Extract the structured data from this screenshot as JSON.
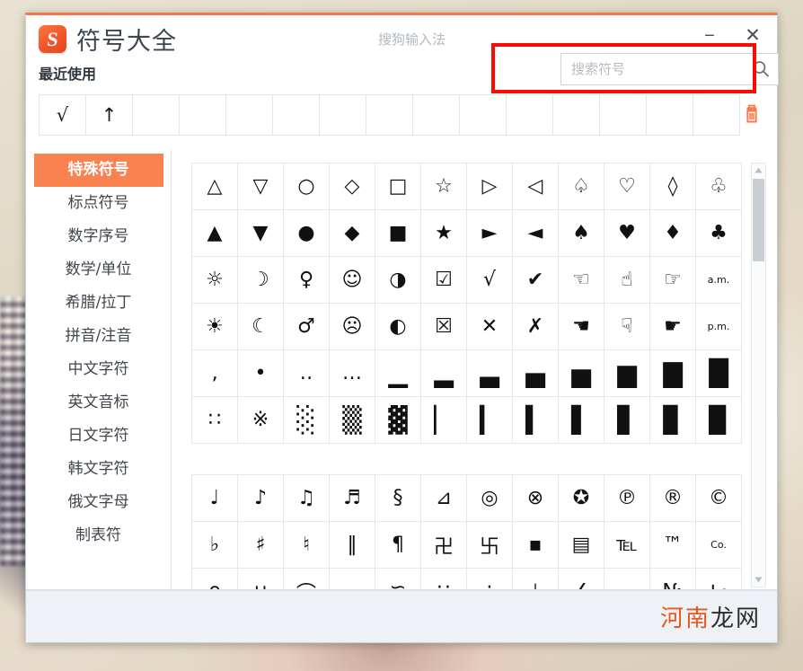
{
  "window": {
    "app_title": "符号大全",
    "product_name": "搜狗输入法",
    "logo_letter": "S",
    "accent_color": "#f2784b",
    "minimize_label": "−",
    "close_label": "✕"
  },
  "recent": {
    "label": "最近使用",
    "symbols": [
      "√",
      "↑",
      "",
      "",
      "",
      "",
      "",
      "",
      "",
      "",
      "",
      "",
      "",
      "",
      ""
    ],
    "clear_tooltip": "清空"
  },
  "search": {
    "placeholder": "搜索符号",
    "value": "",
    "icon": "search-icon",
    "highlight_color": "#fb0b06"
  },
  "sidebar": {
    "items": [
      {
        "label": "特殊符号",
        "active": true
      },
      {
        "label": "标点符号",
        "active": false
      },
      {
        "label": "数字序号",
        "active": false
      },
      {
        "label": "数学/单位",
        "active": false
      },
      {
        "label": "希腊/拉丁",
        "active": false
      },
      {
        "label": "拼音/注音",
        "active": false
      },
      {
        "label": "中文字符",
        "active": false
      },
      {
        "label": "英文音标",
        "active": false
      },
      {
        "label": "日文字符",
        "active": false
      },
      {
        "label": "韩文字符",
        "active": false
      },
      {
        "label": "俄文字母",
        "active": false
      },
      {
        "label": "制表符",
        "active": false
      }
    ],
    "active_bg": "#fa8250"
  },
  "symbol_groups": [
    {
      "name": "shapes-and-marks",
      "rows": [
        [
          "△",
          "▽",
          "○",
          "◇",
          "□",
          "☆",
          "▷",
          "◁",
          "♤",
          "♡",
          "◊",
          "♧"
        ],
        [
          "▲",
          "▼",
          "●",
          "◆",
          "■",
          "★",
          "►",
          "◄",
          "♠",
          "♥",
          "♦",
          "♣"
        ],
        [
          "☼",
          "☽",
          "♀",
          "☺",
          "◑",
          "☑",
          "√",
          "✔",
          "☜",
          "☝",
          "☞",
          "a.m."
        ],
        [
          "☀",
          "☾",
          "♂",
          "☹",
          "◐",
          "☒",
          "✕",
          "✗",
          "☚",
          "☟",
          "☛",
          "p.m."
        ],
        [
          "‚",
          "•",
          "‥",
          "…",
          "▁",
          "▂",
          "▃",
          "▄",
          "▅",
          "▆",
          "▇",
          "█"
        ],
        [
          "∷",
          "※",
          "░",
          "▒",
          "▓",
          "▏",
          "▎",
          "▍",
          "▌",
          "▋",
          "▊",
          "▉"
        ]
      ]
    },
    {
      "name": "music-and-signs",
      "rows": [
        [
          "♩",
          "♪",
          "♫",
          "♬",
          "§",
          "⊿",
          "◎",
          "⊗",
          "✪",
          "℗",
          "®",
          "©"
        ],
        [
          "♭",
          "♯",
          "♮",
          "‖",
          "¶",
          "卍",
          "卐",
          "▪",
          "▤",
          "℡",
          "™",
          "Co."
        ],
        [
          "∩",
          "∪",
          "⌒",
          "∽",
          "≌",
          "∵",
          "∴",
          "⊥",
          "∠",
          "⌓",
          "№",
          "㏑"
        ]
      ]
    }
  ],
  "scrollbar": {
    "up_arrow": "▲",
    "down_arrow": "▼",
    "position": "top"
  },
  "footer": {
    "watermark_prefix": "河南",
    "watermark_suffix": "龙网",
    "prefix_color": "#e8571f",
    "suffix_color": "#2c2c2c"
  }
}
